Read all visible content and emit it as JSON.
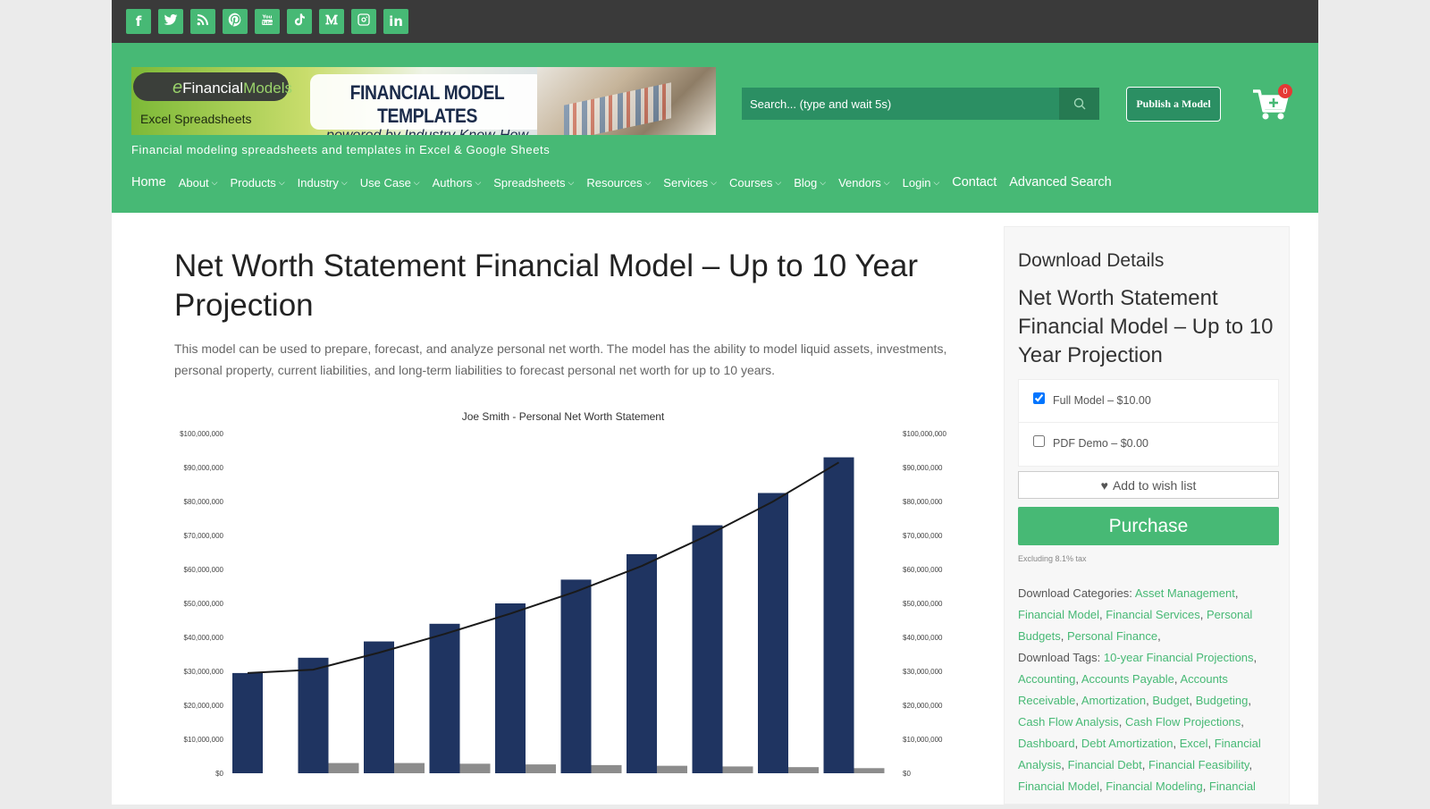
{
  "social": [
    {
      "icon": "facebook-icon",
      "glyph": "f"
    },
    {
      "icon": "twitter-icon",
      "glyph": ""
    },
    {
      "icon": "rss-icon",
      "glyph": ""
    },
    {
      "icon": "pinterest-icon",
      "glyph": ""
    },
    {
      "icon": "youtube-icon",
      "glyph": ""
    },
    {
      "icon": "tiktok-icon",
      "glyph": ""
    },
    {
      "icon": "medium-icon",
      "glyph": ""
    },
    {
      "icon": "instagram-icon",
      "glyph": ""
    },
    {
      "icon": "linkedin-icon",
      "glyph": "in"
    }
  ],
  "brand": {
    "logo_e": "e",
    "logo_financial": "Financial",
    "logo_models": "Models",
    "excel": "Excel Spreadsheets",
    "banner_title": "FINANCIAL MODEL TEMPLATES",
    "banner_sub": "powered by Industry Know-How",
    "tagline": "Financial modeling spreadsheets and templates in Excel & Google Sheets",
    "accent": "#47b975"
  },
  "search": {
    "placeholder": "Search... (type and wait 5s)"
  },
  "publish_label": "Publish a Model",
  "cart_count": "0",
  "nav": [
    {
      "label": "Home",
      "dropdown": false,
      "big": true
    },
    {
      "label": "About",
      "dropdown": true
    },
    {
      "label": "Products",
      "dropdown": true
    },
    {
      "label": "Industry",
      "dropdown": true
    },
    {
      "label": "Use Case",
      "dropdown": true
    },
    {
      "label": "Authors",
      "dropdown": true
    },
    {
      "label": "Spreadsheets",
      "dropdown": true
    },
    {
      "label": "Resources",
      "dropdown": true
    },
    {
      "label": "Services",
      "dropdown": true
    },
    {
      "label": "Courses",
      "dropdown": true
    },
    {
      "label": "Blog",
      "dropdown": true
    },
    {
      "label": "Vendors",
      "dropdown": true
    },
    {
      "label": "Login",
      "dropdown": true
    },
    {
      "label": "Contact",
      "dropdown": false,
      "big": true
    },
    {
      "label": "Advanced Search",
      "dropdown": false,
      "big": true
    }
  ],
  "main": {
    "title": "Net Worth Statement Financial Model – Up to 10 Year Projection",
    "description": "This model can be used to prepare, forecast, and analyze personal net worth. The model has the ability to model liquid assets, investments, personal property, current liabilities, and long-term liabilities to forecast personal net worth for up to 10 years."
  },
  "chart_data": {
    "type": "bar",
    "title": "Joe Smith - Personal Net Worth Statement",
    "y_ticks": [
      "$0",
      "$10,000,000",
      "$20,000,000",
      "$30,000,000",
      "$40,000,000",
      "$50,000,000",
      "$60,000,000",
      "$70,000,000",
      "$80,000,000",
      "$90,000,000",
      "$100,000,000"
    ],
    "ylim": [
      0,
      100000000
    ],
    "series": [
      {
        "values": [
          29500000,
          34000000,
          38800000,
          44000000,
          50000000,
          57000000,
          64500000,
          73000000,
          82500000,
          93000000
        ],
        "color": "#1f3461"
      },
      {
        "values": [
          0,
          3000000,
          3000000,
          2800000,
          2600000,
          2400000,
          2200000,
          2000000,
          1800000,
          1500000
        ],
        "color": "#8c8c8c"
      },
      {
        "type": "line",
        "values": [
          29500000,
          30500000,
          35500000,
          41000000,
          47000000,
          53500000,
          61000000,
          70000000,
          80000000,
          91500000
        ],
        "color": "#1a1a1a"
      }
    ],
    "grid": false
  },
  "sidebar": {
    "heading": "Download Details",
    "title": "Net Worth Statement Financial Model – Up to 10 Year Projection",
    "options": [
      {
        "label": "Full Model – $10.00",
        "checked": true
      },
      {
        "label": "PDF Demo – $0.00",
        "checked": false
      }
    ],
    "wish_label": "Add to wish list",
    "purchase_label": "Purchase",
    "tax_note": "Excluding 8.1% tax",
    "categories_label": "Download Categories:",
    "categories": [
      "Asset Management",
      "Financial Model",
      "Financial Services",
      "Personal Budgets",
      "Personal Finance"
    ],
    "tags_label": "Download Tags:",
    "tags": [
      "10-year Financial Projections",
      "Accounting",
      "Accounts Payable",
      "Accounts Receivable",
      "Amortization",
      "Budget",
      "Budgeting",
      "Cash Flow Analysis",
      "Cash Flow Projections",
      "Dashboard",
      "Debt Amortization",
      "Excel",
      "Financial Analysis",
      "Financial Debt",
      "Financial Feasibility",
      "Financial Model",
      "Financial Modeling",
      "Financial"
    ]
  }
}
